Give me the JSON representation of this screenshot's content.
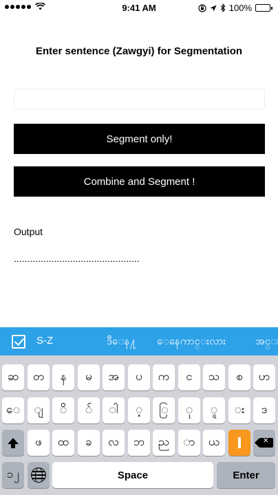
{
  "status_bar": {
    "time": "9:41 AM",
    "battery": "100%",
    "battery_level": 1.0
  },
  "title": "Enter sentence (Zawgyi) for Segmentation",
  "input": {
    "value": "",
    "placeholder": ""
  },
  "buttons": {
    "segment": "Segment only!",
    "combine": "Combine and Segment !"
  },
  "output": {
    "label": "Output",
    "value": "..............................................."
  },
  "suggestions": [
    "S-Z",
    "ဒီေန႔",
    "ေနေကာင္းလား",
    "အင္း"
  ],
  "keyboard": {
    "row1": [
      "ဆ",
      "တ",
      "န",
      "မ",
      "အ",
      "ပ",
      "က",
      "င",
      "သ",
      "စ",
      "ဟ"
    ],
    "row2": [
      "ေ",
      "ျ",
      "ိ",
      "်",
      "ါ",
      "့",
      "ြ",
      "ု",
      "ူ",
      "း",
      "ဒ"
    ],
    "row3": [
      "ဖ",
      "ထ",
      "ခ",
      "လ",
      "ဘ",
      "ည",
      "ာ",
      "ယ"
    ],
    "row4": {
      "left": "၁၂",
      "space": "Space",
      "enter": "Enter"
    }
  },
  "colors": {
    "suggest_bar": "#2ea2e8",
    "button_bg": "#000000",
    "orange_key": "#f7971d",
    "keyboard_bg": "#d1d3d9"
  }
}
